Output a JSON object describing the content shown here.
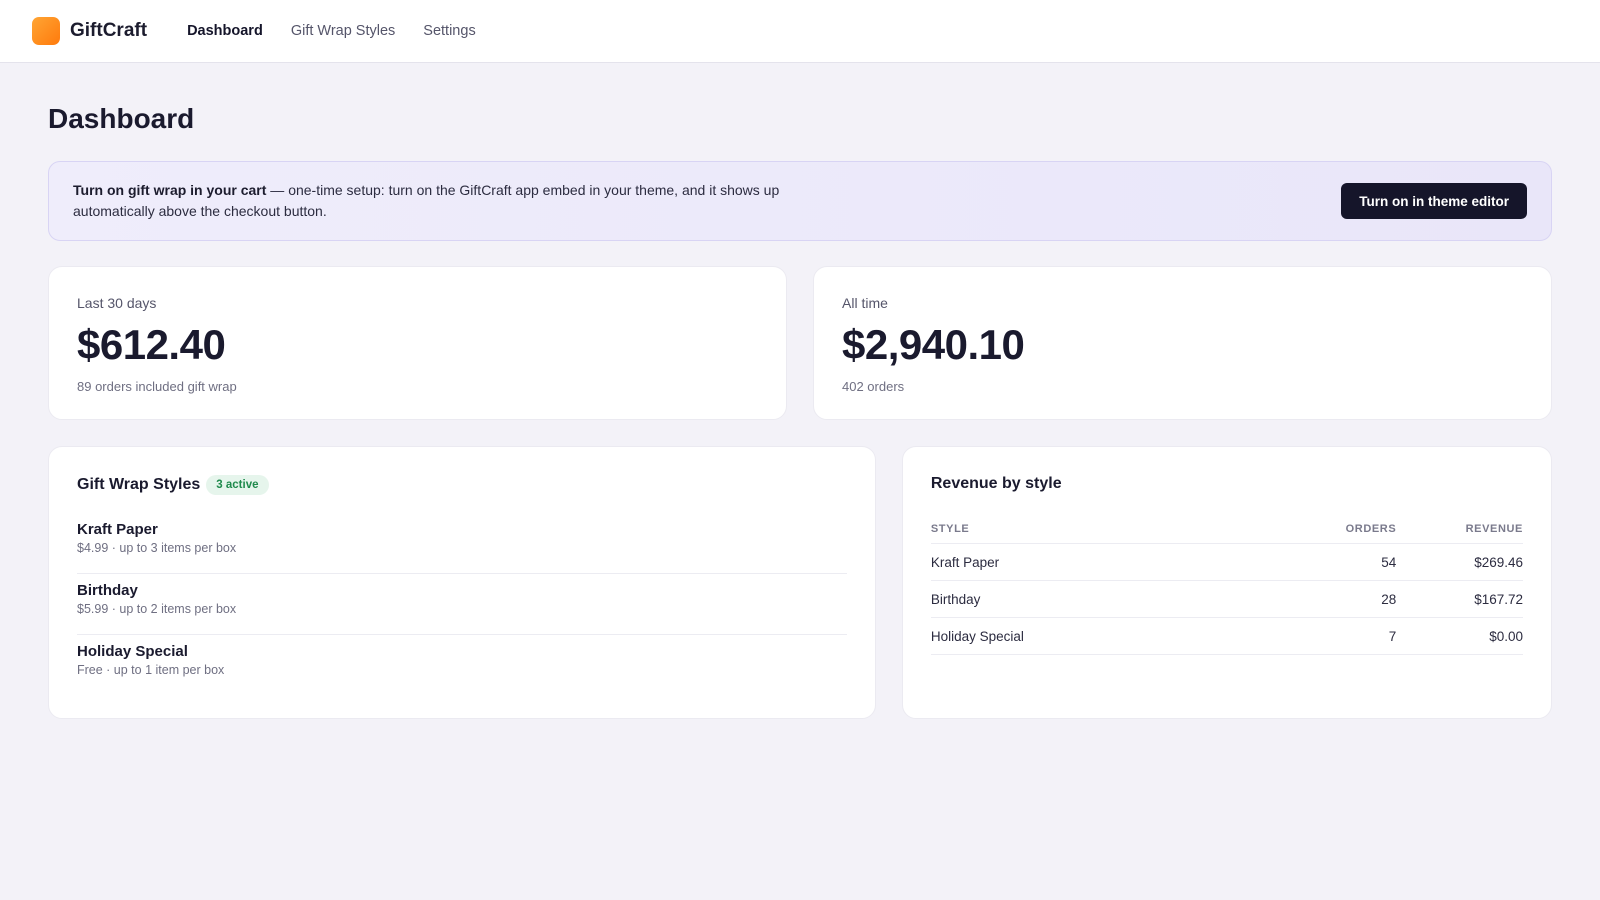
{
  "app": {
    "brand": "GiftCraft",
    "nav": [
      "Dashboard",
      "Gift Wrap Styles",
      "Settings"
    ],
    "active_nav": "Dashboard",
    "accent_color": "#ff8a1c"
  },
  "page": {
    "title": "Dashboard"
  },
  "banner": {
    "bold_text": "Turn on gift wrap in your cart",
    "text": " — one-time setup: turn on the GiftCraft app embed in your theme, and it shows up automatically above the checkout button.",
    "button_label": "Turn on in theme editor"
  },
  "stats": [
    {
      "label": "Last 30 days",
      "value": "$612.40",
      "sub": "89 orders included gift wrap"
    },
    {
      "label": "All time",
      "value": "$2,940.10",
      "sub": "402 orders"
    }
  ],
  "styles_card": {
    "title": "Gift Wrap Styles",
    "badge": "3 active",
    "items": [
      {
        "name": "Kraft Paper",
        "desc": "$4.99 · up to 3 items per box"
      },
      {
        "name": "Birthday",
        "desc": "$5.99 · up to 2 items per box"
      },
      {
        "name": "Holiday Special",
        "desc": "Free · up to 1 item per box"
      }
    ]
  },
  "revenue_card": {
    "title": "Revenue by style",
    "headers": [
      "STYLE",
      "ORDERS",
      "REVENUE"
    ],
    "rows": [
      {
        "style": "Kraft Paper",
        "orders": "54",
        "revenue": "$269.46"
      },
      {
        "style": "Birthday",
        "orders": "28",
        "revenue": "$167.72"
      },
      {
        "style": "Holiday Special",
        "orders": "7",
        "revenue": "$0.00"
      }
    ]
  }
}
